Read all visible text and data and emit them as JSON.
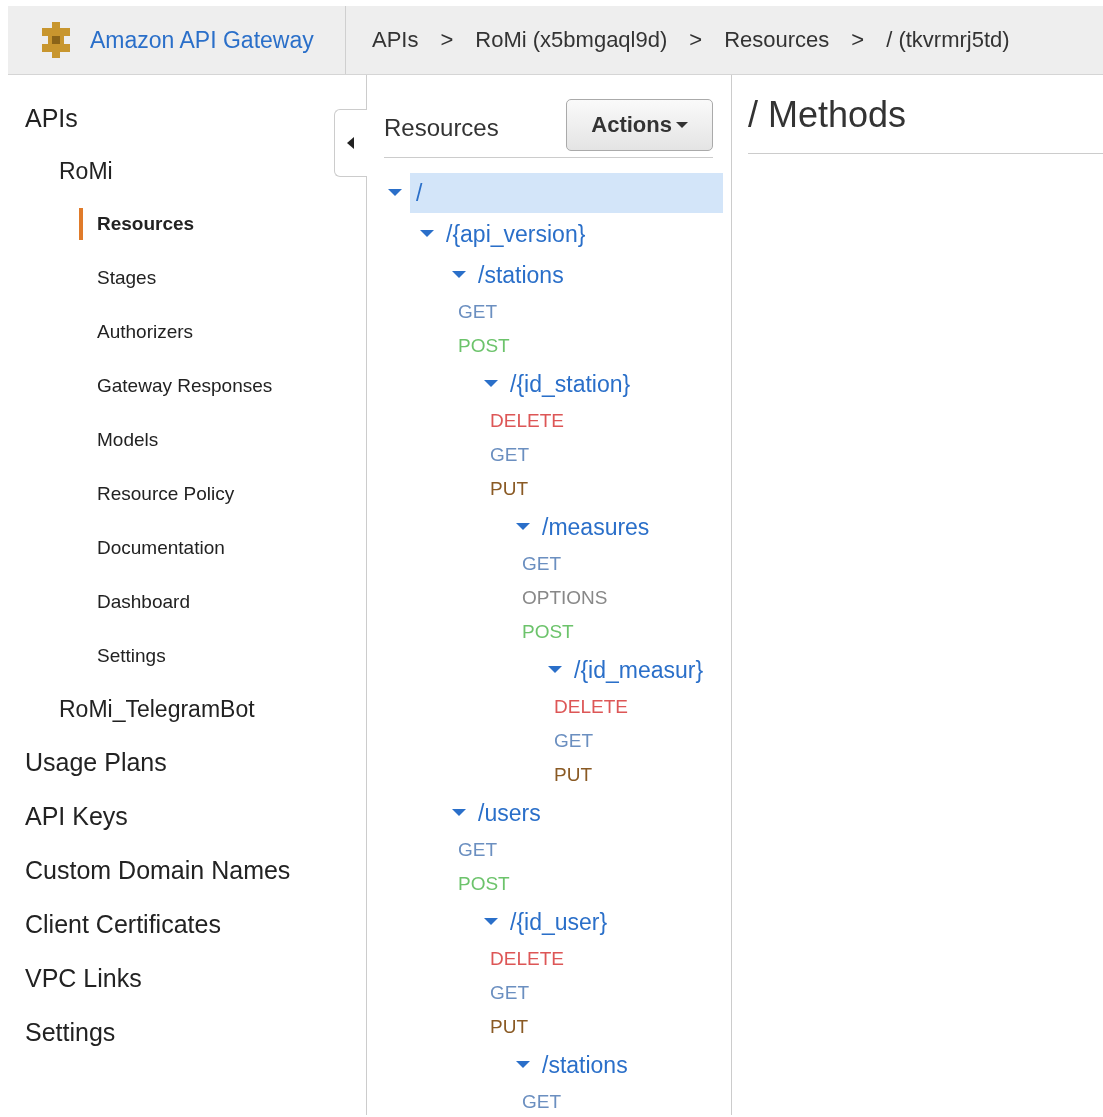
{
  "header": {
    "product": "Amazon API Gateway",
    "separator": ">",
    "breadcrumbs": [
      "APIs",
      "RoMi (x5bmgaql9d)",
      "Resources",
      "/ (tkvrmrj5td)"
    ]
  },
  "sidebar": {
    "items": [
      {
        "label": "APIs",
        "selected": false,
        "children": [
          {
            "label": "RoMi",
            "selected": false,
            "children": [
              {
                "label": "Resources",
                "selected": true
              },
              {
                "label": "Stages",
                "selected": false
              },
              {
                "label": "Authorizers",
                "selected": false
              },
              {
                "label": "Gateway Responses",
                "selected": false
              },
              {
                "label": "Models",
                "selected": false
              },
              {
                "label": "Resource Policy",
                "selected": false
              },
              {
                "label": "Documentation",
                "selected": false
              },
              {
                "label": "Dashboard",
                "selected": false
              },
              {
                "label": "Settings",
                "selected": false
              }
            ]
          },
          {
            "label": "RoMi_TelegramBot",
            "selected": false
          }
        ]
      },
      {
        "label": "Usage Plans",
        "selected": false
      },
      {
        "label": "API Keys",
        "selected": false
      },
      {
        "label": "Custom Domain Names",
        "selected": false
      },
      {
        "label": "Client Certificates",
        "selected": false
      },
      {
        "label": "VPC Links",
        "selected": false
      },
      {
        "label": "Settings",
        "selected": false
      }
    ]
  },
  "resources": {
    "title": "Resources",
    "actions_button": "Actions",
    "tree": [
      {
        "kind": "resource",
        "path": "/",
        "expanded": true,
        "selected": true,
        "children": [
          {
            "kind": "resource",
            "path": "/{api_version}",
            "expanded": true,
            "selected": false,
            "children": [
              {
                "kind": "resource",
                "path": "/stations",
                "expanded": true,
                "selected": false,
                "children": [
                  {
                    "kind": "method",
                    "verb": "GET",
                    "color": "#6b8fc0"
                  },
                  {
                    "kind": "method",
                    "verb": "POST",
                    "color": "#6cc36b"
                  },
                  {
                    "kind": "resource",
                    "path": "/{id_station}",
                    "expanded": true,
                    "selected": false,
                    "children": [
                      {
                        "kind": "method",
                        "verb": "DELETE",
                        "color": "#dd5656"
                      },
                      {
                        "kind": "method",
                        "verb": "GET",
                        "color": "#6b8fc0"
                      },
                      {
                        "kind": "method",
                        "verb": "PUT",
                        "color": "#8a5a24"
                      },
                      {
                        "kind": "resource",
                        "path": "/measures",
                        "expanded": true,
                        "selected": false,
                        "children": [
                          {
                            "kind": "method",
                            "verb": "GET",
                            "color": "#6b8fc0"
                          },
                          {
                            "kind": "method",
                            "verb": "OPTIONS",
                            "color": "#888888"
                          },
                          {
                            "kind": "method",
                            "verb": "POST",
                            "color": "#6cc36b"
                          },
                          {
                            "kind": "resource",
                            "path": "/{id_measur}",
                            "expanded": true,
                            "selected": false,
                            "children": [
                              {
                                "kind": "method",
                                "verb": "DELETE",
                                "color": "#dd5656"
                              },
                              {
                                "kind": "method",
                                "verb": "GET",
                                "color": "#6b8fc0"
                              },
                              {
                                "kind": "method",
                                "verb": "PUT",
                                "color": "#8a5a24"
                              }
                            ]
                          }
                        ]
                      }
                    ]
                  }
                ]
              },
              {
                "kind": "resource",
                "path": "/users",
                "expanded": true,
                "selected": false,
                "children": [
                  {
                    "kind": "method",
                    "verb": "GET",
                    "color": "#6b8fc0"
                  },
                  {
                    "kind": "method",
                    "verb": "POST",
                    "color": "#6cc36b"
                  },
                  {
                    "kind": "resource",
                    "path": "/{id_user}",
                    "expanded": true,
                    "selected": false,
                    "children": [
                      {
                        "kind": "method",
                        "verb": "DELETE",
                        "color": "#dd5656"
                      },
                      {
                        "kind": "method",
                        "verb": "GET",
                        "color": "#6b8fc0"
                      },
                      {
                        "kind": "method",
                        "verb": "PUT",
                        "color": "#8a5a24"
                      },
                      {
                        "kind": "resource",
                        "path": "/stations",
                        "expanded": true,
                        "selected": false,
                        "children": [
                          {
                            "kind": "method",
                            "verb": "GET",
                            "color": "#6b8fc0"
                          }
                        ]
                      }
                    ]
                  }
                ]
              }
            ]
          }
        ]
      }
    ]
  },
  "methods_panel": {
    "title": "/ Methods"
  }
}
